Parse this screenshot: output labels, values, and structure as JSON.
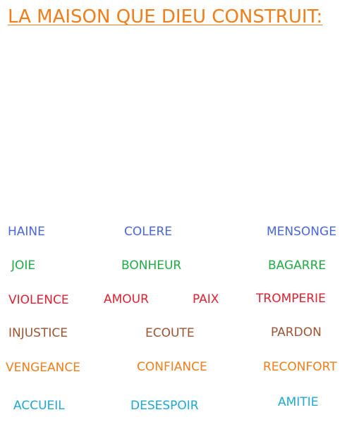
{
  "title": {
    "text": "LA MAISON QUE DIEU CONSTRUIT:",
    "color": "#f07e1b"
  },
  "colors": {
    "blue": "#4a66d8",
    "green": "#22aa44",
    "red": "#dd2233",
    "brown": "#9a5533",
    "orange": "#f07e1b",
    "cyan": "#1fa6d4"
  },
  "words": {
    "haine": "HAINE",
    "colere": "COLERE",
    "mensonge": "MENSONGE",
    "joie": "JOIE",
    "bonheur": "BONHEUR",
    "bagarre": "BAGARRE",
    "violence": "VIOLENCE",
    "amour": "AMOUR",
    "paix": "PAIX",
    "tromperie": "TROMPERIE",
    "injustice": "INJUSTICE",
    "ecoute": "ECOUTE",
    "pardon": "PARDON",
    "vengeance": "VENGEANCE",
    "confiance": "CONFIANCE",
    "reconfort": "RECONFORT",
    "accueil": "ACCUEIL",
    "desespoir": "DESESPOIR",
    "amitie": "AMITIE"
  }
}
